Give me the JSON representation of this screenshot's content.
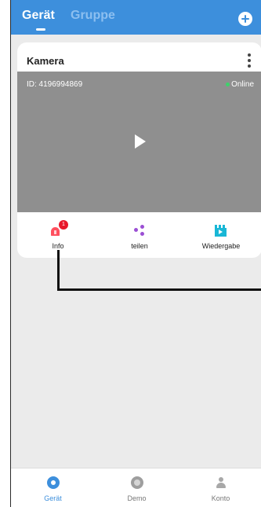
{
  "header": {
    "tabs": [
      "Gerät",
      "Gruppe"
    ],
    "active_tab": "Gerät",
    "add_icon": "plus-circle-icon",
    "accent_color": "#3d8fdc"
  },
  "device_card": {
    "name": "Kamera",
    "id_text": "ID: 4196994869",
    "status": "Online",
    "status_color": "#3dd26b",
    "actions": [
      {
        "label": "Info",
        "icon": "alarm-icon",
        "badge": "1"
      },
      {
        "label": "teilen",
        "icon": "share-icon"
      },
      {
        "label": "Wiedergabe",
        "icon": "playback-icon"
      }
    ]
  },
  "bottom_nav": {
    "items": [
      {
        "label": "Gerät",
        "icon": "device-icon",
        "active": true
      },
      {
        "label": "Demo",
        "icon": "demo-icon",
        "active": false
      },
      {
        "label": "Konto",
        "icon": "account-icon",
        "active": false
      }
    ],
    "active_color": "#3d8fdc",
    "inactive_color": "#777777"
  }
}
